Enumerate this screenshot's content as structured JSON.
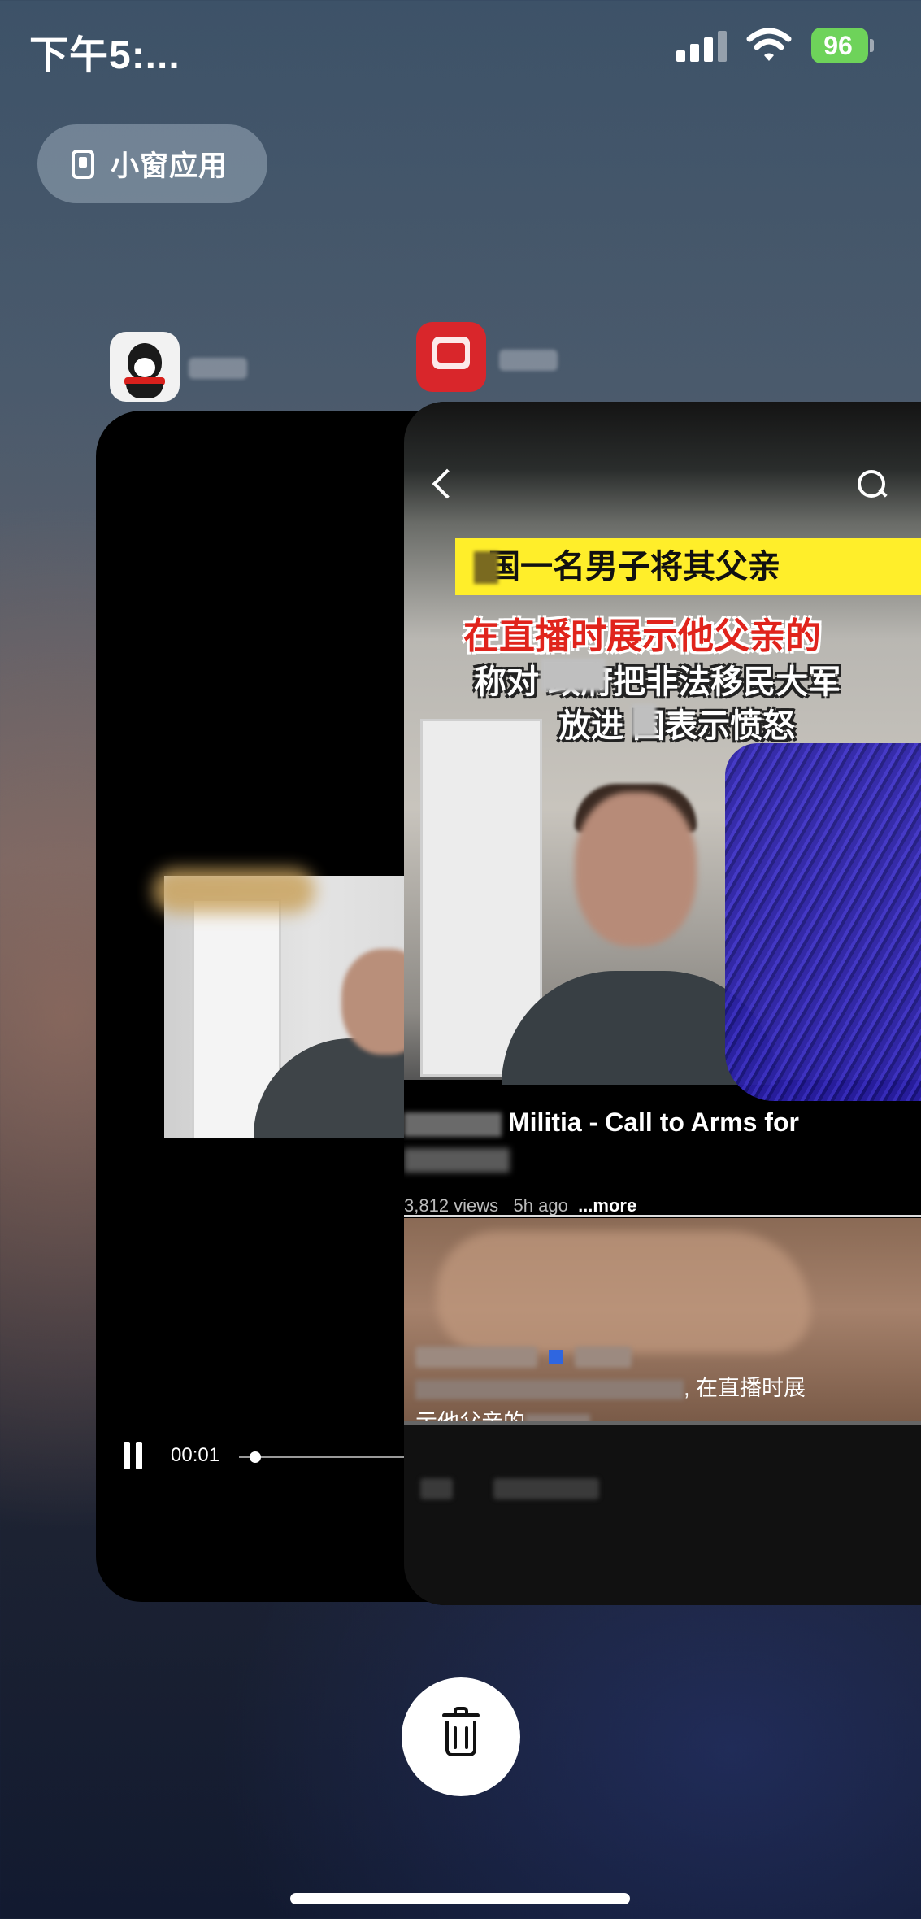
{
  "status_bar": {
    "time": "下午5:...",
    "battery_percent": "96",
    "battery_color": "#6ed35a",
    "signal_bars": 4,
    "icons": [
      "signal-icon",
      "wifi-icon",
      "battery-charging-icon"
    ]
  },
  "small_window": {
    "label": "小窗应用",
    "icon": "small-window-icon"
  },
  "app_switcher": {
    "apps": [
      {
        "icon": "qq-penguin-icon"
      },
      {
        "icon": "news-app-icon"
      }
    ]
  },
  "video_player": {
    "current_time": "00:01",
    "progress": 0.05,
    "controls": [
      "pause-icon"
    ]
  },
  "feed": {
    "headline_line1": "国一名男子将其父亲",
    "headline_line2": "在直播时展示他父亲的",
    "headline_line3": "称对  政府把非法移民大军",
    "headline_line4": "放进 国表示愤怒",
    "video_title": "Militia - Call to Arms for",
    "views": "3,812 views",
    "age": "5h ago",
    "more": "...more",
    "news_text_suffix": ", 在直播时展",
    "news_text_line2_prefix": "示他父亲的",
    "icons": [
      "back-icon",
      "search-icon"
    ]
  },
  "delete_button": {
    "icon": "trash-icon"
  }
}
